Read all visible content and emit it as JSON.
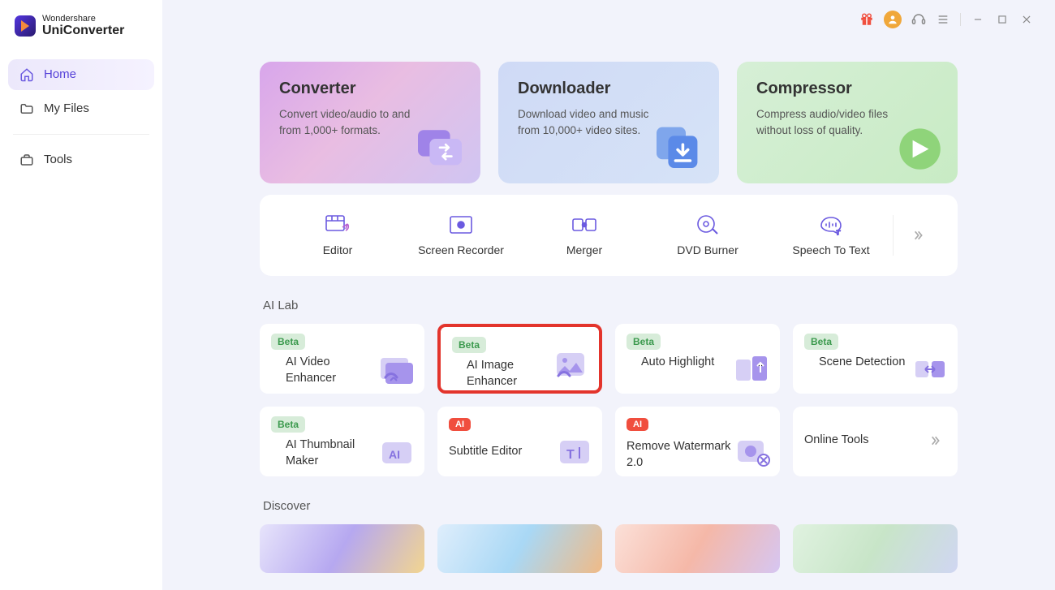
{
  "app": {
    "brand1": "Wondershare",
    "brand2": "UniConverter"
  },
  "nav": {
    "home": "Home",
    "files": "My Files",
    "tools": "Tools"
  },
  "top": {
    "converter": {
      "title": "Converter",
      "desc": "Convert video/audio to and from 1,000+ formats."
    },
    "downloader": {
      "title": "Downloader",
      "desc": "Download video and music from 10,000+ video sites."
    },
    "compressor": {
      "title": "Compressor",
      "desc": "Compress audio/video files without loss of quality."
    }
  },
  "toolbar": {
    "items": [
      "Editor",
      "Screen Recorder",
      "Merger",
      "DVD Burner",
      "Speech To Text"
    ]
  },
  "sections": {
    "ailab": "AI Lab",
    "discover": "Discover"
  },
  "ailab": {
    "beta": "Beta",
    "ai": "AI",
    "items": {
      "video_enh": "AI Video Enhancer",
      "image_enh": "AI Image Enhancer",
      "auto_hl": "Auto Highlight",
      "scene": "Scene Detection",
      "thumb": "AI Thumbnail Maker",
      "subtitle": "Subtitle Editor",
      "watermark": "Remove Watermark 2.0",
      "online": "Online Tools"
    }
  }
}
